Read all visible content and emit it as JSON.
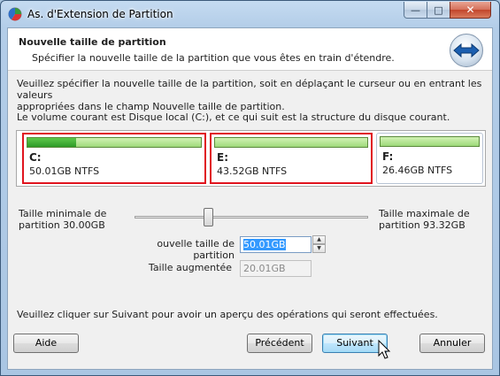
{
  "window": {
    "title": "As. d'Extension de Partition",
    "min_glyph": "—",
    "max_glyph": "□",
    "close_glyph": "✕"
  },
  "header": {
    "title": "Nouvelle taille de partition",
    "subtitle": "Spécifier la nouvelle taille de la partition que vous êtes en train d'étendre."
  },
  "body": {
    "instruction_line1": "Veuillez spécifier la nouvelle taille de la partition, soit en déplaçant le curseur ou en entrant les valeurs",
    "instruction_line2": "appropriées dans le champ Nouvelle taille de partition.",
    "disk_info": "Le volume courant est Disque local (C:), et ce qui suit est la structure du disque courant."
  },
  "partitions": [
    {
      "letter": "C:",
      "size": "50.01GB NTFS",
      "used_fraction": 0.28,
      "selected": true
    },
    {
      "letter": "E:",
      "size": "43.52GB NTFS",
      "used_fraction": 0.0,
      "selected": true
    },
    {
      "letter": "F:",
      "size": "26.46GB NTFS",
      "used_fraction": 0.0,
      "selected": false
    }
  ],
  "slider": {
    "min_label_line1": "Taille minimale de",
    "min_label_line2": "partition 30.00GB",
    "max_label_line1": "Taille maximale de",
    "max_label_line2": "partition 93.32GB",
    "position_fraction": 0.32
  },
  "fields": {
    "new_size_label": "ouvelle taille de partition",
    "new_size_value": "50.01GB",
    "increased_label": "Taille augmentée",
    "increased_value": "20.01GB"
  },
  "footer": {
    "note": "Veuillez cliquer sur Suivant pour avoir un aperçu des opérations qui seront effectuées."
  },
  "buttons": {
    "help": "Aide",
    "previous": "Précédent",
    "next": "Suivant",
    "cancel": "Annuler"
  },
  "colors": {
    "selection_border": "#e0141e",
    "used_fill": "#2d9a26",
    "free_fill": "#9ed97a"
  }
}
